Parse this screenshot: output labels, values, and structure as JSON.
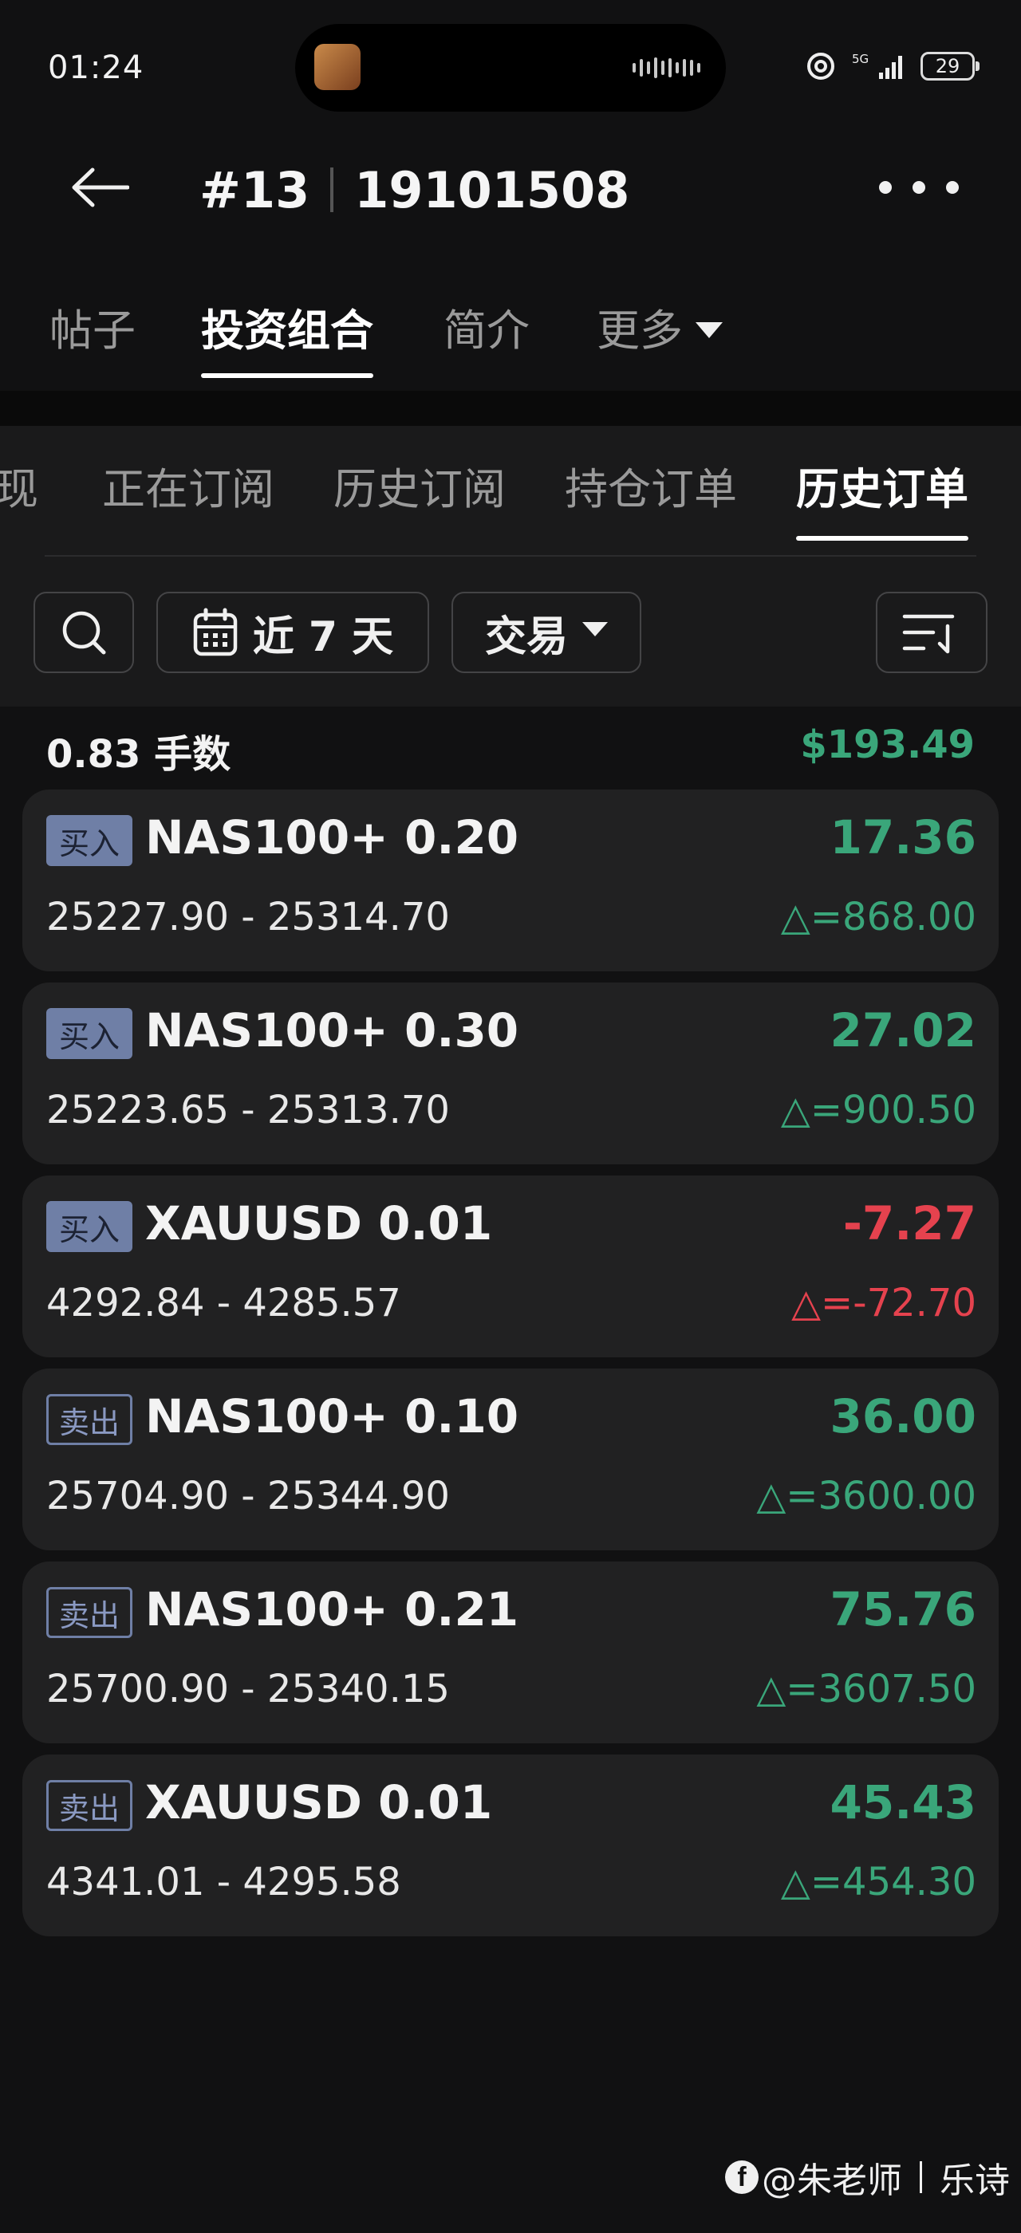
{
  "status_bar": {
    "time": "01:24",
    "network": "5G",
    "battery": "29"
  },
  "header": {
    "title_number": "#13",
    "title_account": "19101508"
  },
  "main_tabs": [
    {
      "label": "帖子"
    },
    {
      "label": "投资组合"
    },
    {
      "label": "简介"
    },
    {
      "label": "更多"
    }
  ],
  "sub_tabs": [
    {
      "label": "现"
    },
    {
      "label": "正在订阅"
    },
    {
      "label": "历史订阅"
    },
    {
      "label": "持仓订单"
    },
    {
      "label": "历史订单"
    }
  ],
  "filters": {
    "date_range": "近 7 天",
    "type": "交易"
  },
  "summary": {
    "lots": "0.83 手数",
    "total": "$193.49"
  },
  "orders": [
    {
      "side": "买入",
      "symbol": "NAS100+ 0.20",
      "range": "25227.90 - 25314.70",
      "profit": "17.36",
      "delta": "△=868.00"
    },
    {
      "side": "买入",
      "symbol": "NAS100+ 0.30",
      "range": "25223.65 - 25313.70",
      "profit": "27.02",
      "delta": "△=900.50"
    },
    {
      "side": "买入",
      "symbol": "XAUUSD 0.01",
      "range": "4292.84 - 4285.57",
      "profit": "-7.27",
      "delta": "△=-72.70"
    },
    {
      "side": "卖出",
      "symbol": "NAS100+ 0.10",
      "range": "25704.90 - 25344.90",
      "profit": "36.00",
      "delta": "△=3600.00"
    },
    {
      "side": "卖出",
      "symbol": "NAS100+ 0.21",
      "range": "25700.90 - 25340.15",
      "profit": "75.76",
      "delta": "△=3607.50"
    },
    {
      "side": "卖出",
      "symbol": "XAUUSD 0.01",
      "range": "4341.01 - 4295.58",
      "profit": "45.43",
      "delta": "△=454.30"
    }
  ],
  "watermark": {
    "handle": "@朱老师",
    "name": "乐诗"
  },
  "colors": {
    "positive": "#3aa67a",
    "negative": "#e5424e",
    "badge": "#6f7fa6"
  }
}
